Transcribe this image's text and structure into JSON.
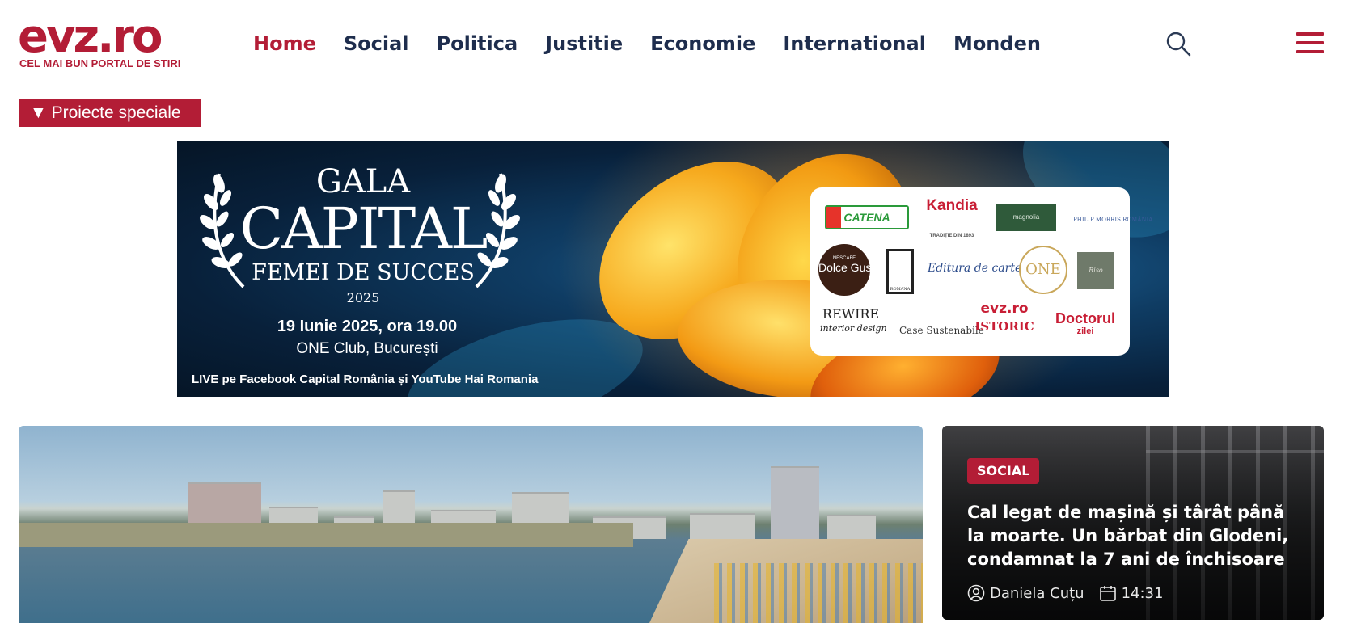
{
  "header": {
    "logo_text": "evz.ro",
    "logo_tagline": "CEL MAI BUN PORTAL DE STIRI",
    "nav": [
      {
        "label": "Home",
        "active": true
      },
      {
        "label": "Social",
        "active": false
      },
      {
        "label": "Politica",
        "active": false
      },
      {
        "label": "Justitie",
        "active": false
      },
      {
        "label": "Economie",
        "active": false
      },
      {
        "label": "International",
        "active": false
      },
      {
        "label": "Monden",
        "active": false
      }
    ],
    "search_icon": "search-icon",
    "menu_icon": "hamburger-menu-icon",
    "special_projects_label": "▼ Proiecte speciale"
  },
  "banner": {
    "gala_label": "GALA",
    "title": "CAPITAL",
    "subtitle": "FEMEI DE SUCCES",
    "year": "2025",
    "date_line": "19 Iunie 2025, ora 19.00",
    "venue_line": "ONE Club, București",
    "live_line": "LIVE pe Facebook Capital România și YouTube Hai Romania",
    "sponsors": {
      "catena": "CATENA",
      "kandia": "Kandia",
      "kandia_sub": "TRADIȚIE DIN 1893",
      "magnolia": "magnolia",
      "philip_morris": "PHILIP MORRIS ROMÂNIA",
      "dolce_gusto": "Dolce Gusto",
      "nescafe": "NESCAFÉ",
      "galeria": "ROMANA",
      "editura": "Editura de carte",
      "one": "ONE",
      "riso": "Riso",
      "rewire": "REWIRE",
      "rewire_sub": "interior design",
      "case": "Case Sustenabile",
      "evz": "evz.ro",
      "istoric": "ISTORIC",
      "doctorul": "Doctorul",
      "doctorul_sub": "zilei"
    }
  },
  "side_article": {
    "category": "SOCIAL",
    "title": "Cal legat de mașină și târât până la moarte. Un bărbat din Glodeni, condamnat la 7 ani de închisoare",
    "author": "Daniela Cuțu",
    "time": "14:31"
  },
  "colors": {
    "brand_red": "#b31d36",
    "nav_text": "#1e2d4d"
  }
}
